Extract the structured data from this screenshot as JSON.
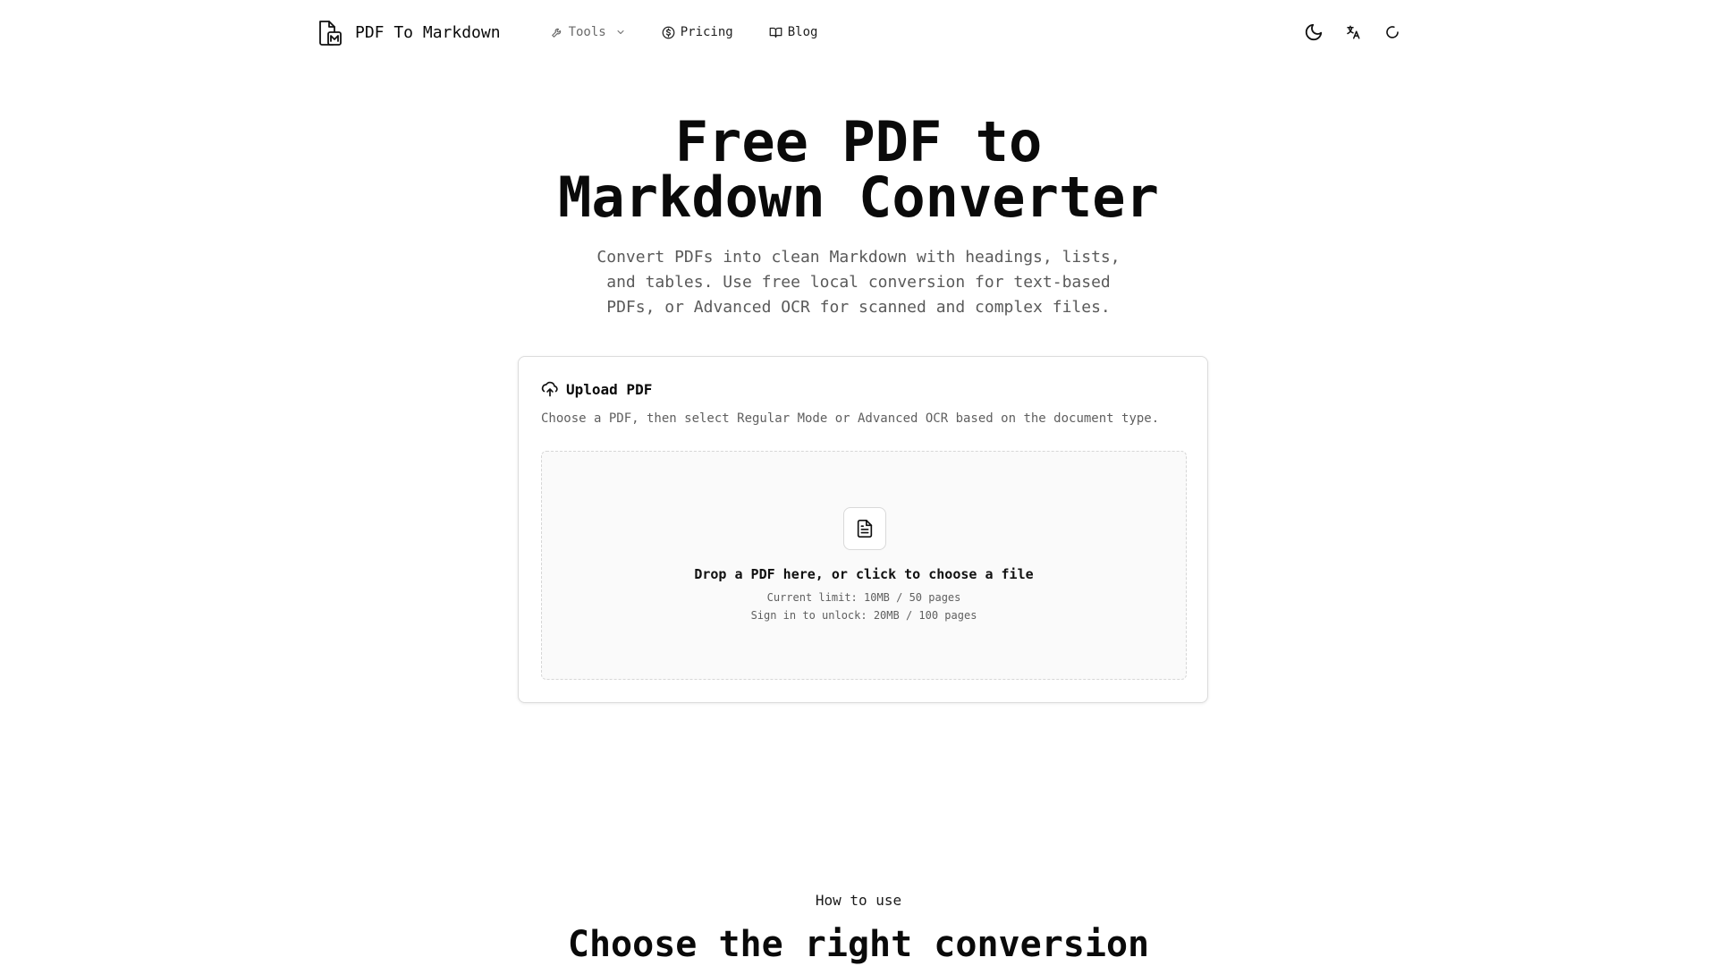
{
  "header": {
    "brand_name": "PDF To Markdown",
    "nav": {
      "tools": "Tools",
      "pricing": "Pricing",
      "blog": "Blog"
    },
    "actions": [
      "moon-icon",
      "translate-icon",
      "loading-spinner-icon"
    ]
  },
  "hero": {
    "title_line1": "Free PDF to",
    "title_line2": "Markdown Converter",
    "subtitle_line1": "Convert PDFs into clean Markdown with headings, lists,",
    "subtitle_line2": "and tables. Use free local conversion for text-based",
    "subtitle_line3": "PDFs, or Advanced OCR for scanned and complex files."
  },
  "upload": {
    "title": "Upload PDF",
    "description": "Choose a PDF, then select Regular Mode or Advanced OCR based on the document type.",
    "drop_title": "Drop a PDF here, or click to choose a file",
    "current_limit": "Current limit: 10MB / 50 pages",
    "unlock_limit": "Sign in to unlock: 20MB / 100 pages"
  },
  "how_to_use": {
    "label": "How to use",
    "title": "Choose the right conversion"
  },
  "colors": {
    "text": "#0a0a0a",
    "muted": "#5f5f5f",
    "border": "#dcdcdc",
    "dropzone_bg": "#fafafa"
  }
}
